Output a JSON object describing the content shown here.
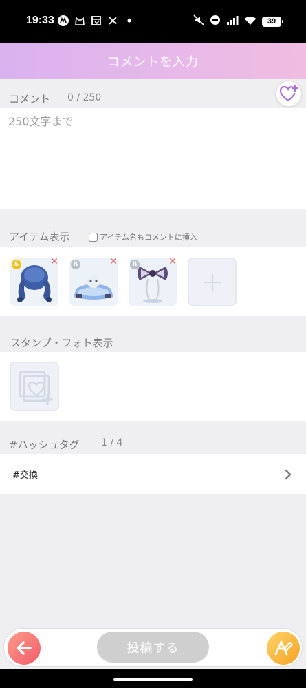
{
  "status_bar": {
    "time": "19:33",
    "battery": "39",
    "left_icons": [
      "m-icon",
      "cat-icon",
      "box-icon",
      "x-icon",
      "dot-icon"
    ],
    "right_icons": [
      "mute-icon",
      "minus-circle-icon",
      "signal-icon",
      "wifi-icon",
      "battery-icon"
    ]
  },
  "header": {
    "title": "コメントを入力"
  },
  "comment": {
    "label": "コメント",
    "counter": "0 / 250",
    "placeholder": "250文字まで",
    "value": ""
  },
  "items": {
    "label": "アイテム表示",
    "checkbox_label": "アイテム名もコメントに挿入",
    "checkbox_checked": false,
    "list": [
      {
        "rank": "S",
        "rank_color": "#f2c21b",
        "name": "hair-item-image"
      },
      {
        "rank": "R",
        "rank_color": "#b9bfc9",
        "name": "dress-item-image"
      },
      {
        "rank": "R",
        "rank_color": "#b9bfc9",
        "name": "bow-item-image"
      }
    ]
  },
  "stamp": {
    "label": "スタンプ・フォト表示"
  },
  "hashtag": {
    "label": "#ハッシュタグ",
    "counter": "1 / 4",
    "value": "#交換"
  },
  "bottom": {
    "post_label": "投稿する"
  },
  "colors": {
    "header_start": "#d9b2f0",
    "header_end": "#f0bde0",
    "accent_purple": "#a86fd8",
    "back_button": "#f25c6a",
    "ai_button": "#f5a323",
    "post_disabled": "#cfcfcf"
  }
}
